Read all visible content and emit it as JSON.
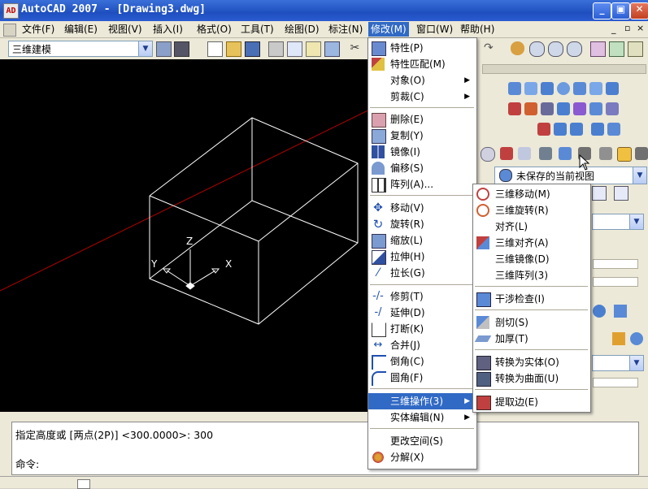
{
  "window": {
    "title": "AutoCAD 2007 - [Drawing3.dwg]",
    "app_icon_label": "AD",
    "buttons": {
      "minimize": "_",
      "restore": "▣",
      "close": "✕"
    }
  },
  "menubar": {
    "items": [
      {
        "label": "文件(F)"
      },
      {
        "label": "编辑(E)"
      },
      {
        "label": "视图(V)"
      },
      {
        "label": "插入(I)"
      },
      {
        "label": "格式(O)"
      },
      {
        "label": "工具(T)"
      },
      {
        "label": "绘图(D)"
      },
      {
        "label": "标注(N)"
      },
      {
        "label": "修改(M)"
      },
      {
        "label": "窗口(W)"
      },
      {
        "label": "帮助(H)"
      }
    ],
    "active_index": 8
  },
  "toolbar": {
    "workspace_value": "三维建模"
  },
  "view_select": {
    "value": "未保存的当前视图"
  },
  "drawing": {
    "axis_labels": {
      "x": "X",
      "y": "Y",
      "z": "Z"
    },
    "background": "#000000",
    "line_color": "#ffffff",
    "construction_line_color": "#b40000"
  },
  "modify_menu": {
    "items": [
      {
        "label": "特性(P)",
        "icon": "properties-icon"
      },
      {
        "label": "特性匹配(M)",
        "icon": "match-properties-icon"
      },
      {
        "label": "对象(O)",
        "submenu": true
      },
      {
        "label": "剪裁(C)",
        "submenu": true
      },
      {
        "label": "删除(E)",
        "icon": "erase-icon"
      },
      {
        "label": "复制(Y)",
        "icon": "copy-icon"
      },
      {
        "label": "镜像(I)",
        "icon": "mirror-icon"
      },
      {
        "label": "偏移(S)",
        "icon": "offset-icon"
      },
      {
        "label": "阵列(A)...",
        "icon": "array-icon"
      },
      {
        "label": "移动(V)",
        "icon": "move-icon"
      },
      {
        "label": "旋转(R)",
        "icon": "rotate-icon"
      },
      {
        "label": "缩放(L)",
        "icon": "scale-icon"
      },
      {
        "label": "拉伸(H)",
        "icon": "stretch-icon"
      },
      {
        "label": "拉长(G)",
        "icon": "lengthen-icon"
      },
      {
        "label": "修剪(T)",
        "icon": "trim-icon"
      },
      {
        "label": "延伸(D)",
        "icon": "extend-icon"
      },
      {
        "label": "打断(K)",
        "icon": "break-icon"
      },
      {
        "label": "合并(J)",
        "icon": "join-icon"
      },
      {
        "label": "倒角(C)",
        "icon": "chamfer-icon"
      },
      {
        "label": "圆角(F)",
        "icon": "fillet-icon"
      },
      {
        "label": "三维操作(3)",
        "submenu": true,
        "highlighted": true
      },
      {
        "label": "实体编辑(N)",
        "submenu": true
      },
      {
        "label": "更改空间(S)"
      },
      {
        "label": "分解(X)",
        "icon": "explode-icon"
      }
    ]
  },
  "operations_3d_menu": {
    "items": [
      {
        "label": "三维移动(M)",
        "icon": "3d-move-icon"
      },
      {
        "label": "三维旋转(R)",
        "icon": "3d-rotate-icon"
      },
      {
        "label": "对齐(L)"
      },
      {
        "label": "三维对齐(A)",
        "icon": "3d-align-icon"
      },
      {
        "label": "三维镜像(D)"
      },
      {
        "label": "三维阵列(3)"
      },
      {
        "label": "干涉检查(I)",
        "icon": "interference-icon"
      },
      {
        "label": "剖切(S)",
        "icon": "slice-icon"
      },
      {
        "label": "加厚(T)",
        "icon": "thicken-icon"
      },
      {
        "label": "转换为实体(O)",
        "icon": "convert-solid-icon"
      },
      {
        "label": "转换为曲面(U)",
        "icon": "convert-surface-icon"
      },
      {
        "label": "提取边(E)",
        "icon": "extract-edges-icon"
      }
    ]
  },
  "command_line": {
    "history": "指定高度或 [两点(2P)] <300.0000>: 300",
    "prompt": "命令:"
  },
  "colors": {
    "menu_highlight": "#316ac5",
    "titlebar": "#2a5bd0",
    "chrome": "#ece9d8"
  }
}
